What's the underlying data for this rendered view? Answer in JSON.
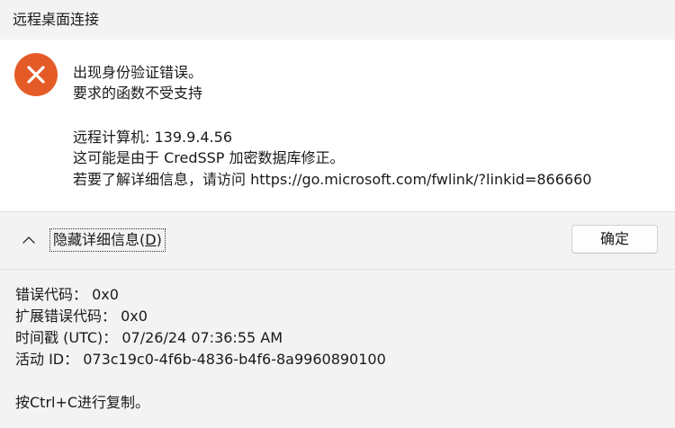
{
  "window": {
    "title": "远程桌面连接"
  },
  "message": {
    "icon": "error-x-icon",
    "icon_color": "#e55b27",
    "line1": "出现身份验证错误。",
    "line2": "要求的函数不受支持",
    "line3": "远程计算机: 139.9.4.56",
    "line4": "这可能是由于 CredSSP 加密数据库修正。",
    "line5": "若要了解详细信息，请访问 https://go.microsoft.com/fwlink/?linkid=866660"
  },
  "controls": {
    "toggle_label": "隐藏详细信息(",
    "toggle_mnemonic": "D",
    "toggle_suffix": ")",
    "ok_label": "确定"
  },
  "details": {
    "error_code": "错误代码： 0x0",
    "extended_error_code": "扩展错误代码： 0x0",
    "timestamp": "时间戳 (UTC)： 07/26/24 07:36:55 AM",
    "activity_id": "活动 ID： 073c19c0-4f6b-4836-b4f6-8a9960890100",
    "copy_hint": "按Ctrl+C进行复制。"
  }
}
